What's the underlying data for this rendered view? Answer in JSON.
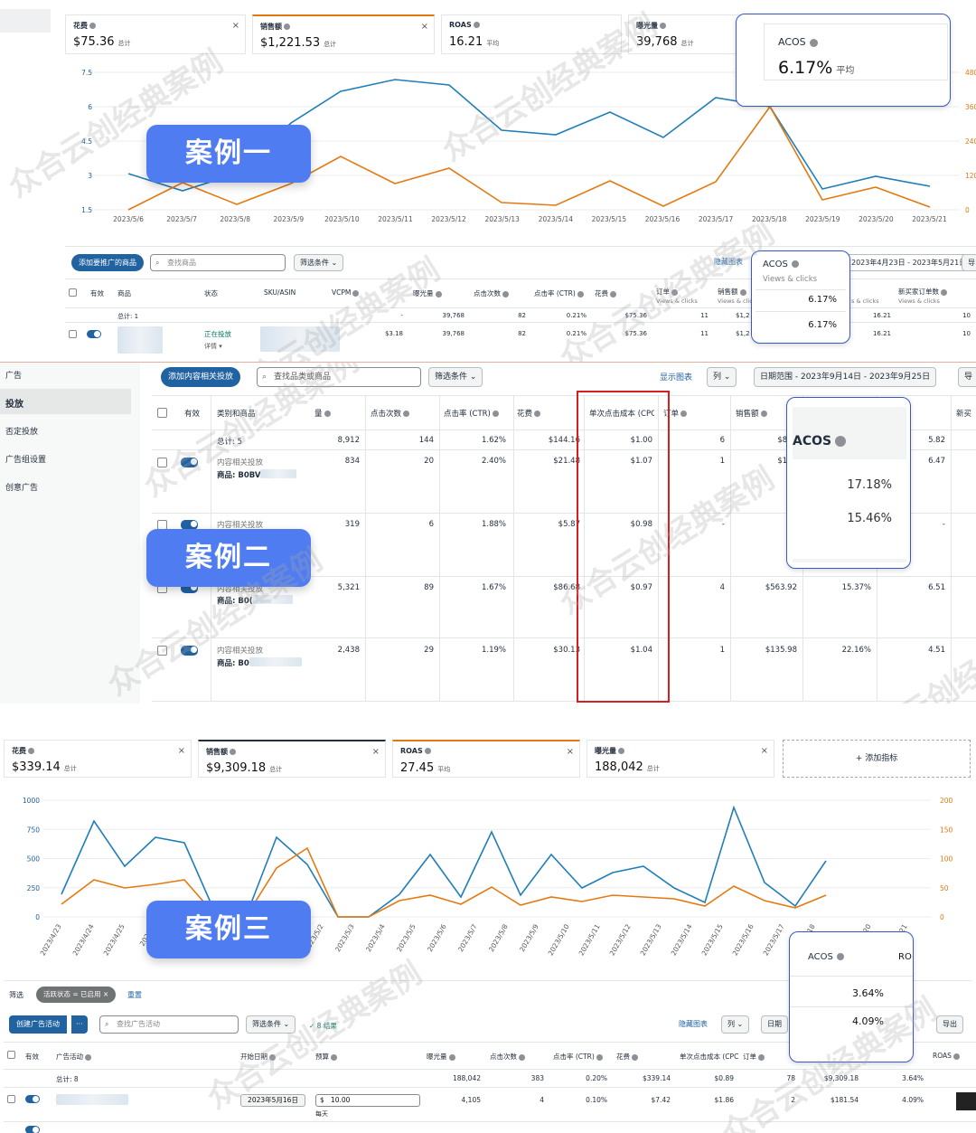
{
  "watermark": "众合云创经典案例",
  "case1": {
    "badge": "案例一",
    "metrics": [
      {
        "title": "花费",
        "value": "$75.36",
        "sub": "总计",
        "accent": "#e3e6e6"
      },
      {
        "title": "销售额",
        "value": "$1,221.53",
        "sub": "总计",
        "accent": "#e47911"
      },
      {
        "title": "ROAS",
        "value": "16.21",
        "sub": "平均",
        "accent": "#e3e6e6"
      },
      {
        "title": "曝光量",
        "value": "39,768",
        "sub": "总计",
        "accent": "#e3e6e6"
      }
    ],
    "acos_card": {
      "title": "ACOS",
      "value": "6.17%",
      "sub": "平均"
    },
    "close_glyph": "×",
    "chart": {
      "left_ticks": [
        "7.5",
        "6",
        "4.5",
        "3",
        "1.5"
      ],
      "right_ticks": [
        "480",
        "360",
        "240",
        "120",
        "0"
      ],
      "x_labels": [
        "2023/5/6",
        "2023/5/7",
        "2023/5/8",
        "2023/5/9",
        "2023/5/10",
        "2023/5/11",
        "2023/5/12",
        "2023/5/13",
        "2023/5/14",
        "2023/5/15",
        "2023/5/16",
        "2023/5/17",
        "2023/5/18",
        "2023/5/19",
        "2023/5/20",
        "2023/5/21"
      ]
    },
    "toolbar": {
      "add_button": "添加要推广的商品",
      "search_placeholder": "查找商品",
      "filter": "筛选条件",
      "hide_chart": "隐藏图表",
      "date_range": "2023年4月23日 - 2023年5月21日",
      "export": "导"
    },
    "table": {
      "headers": [
        "有效",
        "商品",
        "状态",
        "SKU/ASIN",
        "VCPM",
        "曝光量",
        "点击次数",
        "点击率 (CTR)",
        "花费",
        "订单",
        "销售额",
        "ACOS",
        "ROAS",
        "新买家订单数"
      ],
      "sub_headers": {
        "orders": "Views & clicks",
        "sales": "Views & clic",
        "roas": "s & clicks",
        "new": "Views & clicks"
      },
      "total_label": "总计: 1",
      "total": {
        "vcpm": "-",
        "impressions": "39,768",
        "clicks": "82",
        "ctr": "0.21%",
        "spend": "$75.36",
        "orders": "11",
        "sales": "$1,2",
        "roas": "16.21",
        "new": "10"
      },
      "row": {
        "status": "正在投放",
        "detail": "详情",
        "vcpm": "$3.18",
        "impressions": "39,768",
        "clicks": "82",
        "ctr": "0.21%",
        "spend": "$75.36",
        "orders": "11",
        "sales": "$1,2",
        "roas": "16.21",
        "new": "10"
      }
    },
    "acos_callout": {
      "title": "ACOS",
      "sub": "Views & clicks",
      "v1": "6.17%",
      "v2": "6.17%"
    }
  },
  "case2": {
    "badge": "案例二",
    "sidebar": [
      "广告",
      "投放",
      "否定投放",
      "广告组设置",
      "创意广告"
    ],
    "toolbar": {
      "add_button": "添加内容相关投放",
      "search_placeholder": "查找品类或商品",
      "filter": "筛选条件",
      "show_chart": "显示图表",
      "columns": "列",
      "date_range": "日期范围 - 2023年9月14日 - 2023年9月25日",
      "export": "导"
    },
    "headers": [
      "有效",
      "类别和商品",
      "量",
      "点击次数",
      "点击率 (CTR)",
      "花费",
      "单次点击成本 (CPC)",
      "订单",
      "销售额",
      "ACOS",
      "新买"
    ],
    "total": {
      "label": "总计: 5",
      "impr": "8,912",
      "clicks": "144",
      "ctr": "1.62%",
      "spend": "$144.16",
      "cpc": "$1.00",
      "orders": "6",
      "sales": "$838",
      "new": "5.82"
    },
    "rows": [
      {
        "cat": "内容相关投放",
        "prod": "商品: B0BV",
        "impr": "834",
        "clicks": "20",
        "ctr": "2.40%",
        "spend": "$21.48",
        "cpc": "$1.07",
        "orders": "1",
        "sales": "$138",
        "acos": "",
        "new": "6.47"
      },
      {
        "cat": "内容相关投放",
        "prod": "",
        "impr": "319",
        "clicks": "6",
        "ctr": "1.88%",
        "spend": "$5.87",
        "cpc": "$0.98",
        "orders": "-",
        "sales": "",
        "acos": "",
        "new": "-"
      },
      {
        "cat": "内容相关投放",
        "prod": "商品: B0(",
        "impr": "5,321",
        "clicks": "89",
        "ctr": "1.67%",
        "spend": "$86.68",
        "cpc": "$0.97",
        "orders": "4",
        "sales": "$563.92",
        "acos": "15.37%",
        "new": "6.51"
      },
      {
        "cat": "内容相关投放",
        "prod": "商品: B0",
        "impr": "2,438",
        "clicks": "29",
        "ctr": "1.19%",
        "spend": "$30.13",
        "cpc": "$1.04",
        "orders": "1",
        "sales": "$135.98",
        "acos": "22.16%",
        "new": "4.51"
      }
    ],
    "acos_callout": {
      "title": "ACOS",
      "v1": "17.18%",
      "v2": "15.46%"
    }
  },
  "case3": {
    "badge": "案例三",
    "metrics": [
      {
        "title": "花费",
        "value": "$339.14",
        "sub": "总计",
        "accent": "#e3e6e6"
      },
      {
        "title": "销售额",
        "value": "$9,309.18",
        "sub": "总计",
        "accent": "#232f3e"
      },
      {
        "title": "ROAS",
        "value": "27.45",
        "sub": "平均",
        "accent": "#e47911"
      },
      {
        "title": "曝光量",
        "value": "188,042",
        "sub": "总计",
        "accent": "#e3e6e6"
      }
    ],
    "add_metric": "+ 添加指标",
    "chart": {
      "left_ticks": [
        "1000",
        "750",
        "500",
        "250",
        "0"
      ],
      "right_ticks": [
        "200",
        "150",
        "100",
        "50",
        "0"
      ],
      "x_labels": [
        "2023/4/23",
        "2023/4/24",
        "2023/4/25",
        "2023/4",
        "2023/5/2",
        "2023/5/3",
        "2023/5/4",
        "2023/5/5",
        "2023/5/6",
        "2023/5/7",
        "2023/5/8",
        "2023/5/9",
        "2023/5/10",
        "2023/5/11",
        "2023/5/12",
        "2023/5/13",
        "2023/5/14",
        "2023/5/15",
        "2023/5/16",
        "2023/5/17",
        "18",
        "20",
        "21"
      ]
    },
    "filter_row": {
      "label": "筛选",
      "chip": "活跃状态 = 已启用",
      "reset": "重置"
    },
    "toolbar": {
      "create": "创建广告活动",
      "more": "···",
      "search_placeholder": "查找广告活动",
      "filter": "筛选条件",
      "results": "8 结果",
      "hide_chart": "隐藏图表",
      "columns": "列",
      "date": "日期",
      "export": "导出"
    },
    "headers": [
      "有效",
      "广告活动",
      "开始日期",
      "预算",
      "曝光量",
      "点击次数",
      "点击率 (CTR)",
      "花费",
      "单次点击成本 (CPC)",
      "订单",
      "销售额",
      "ACOS",
      "ROAS"
    ],
    "total": {
      "label": "总计: 8",
      "impr": "188,042",
      "clicks": "383",
      "ctr": "0.20%",
      "spend": "$339.14",
      "cpc": "$0.89",
      "orders": "78",
      "sales": "$9,309.18",
      "acos": "3.64%"
    },
    "row": {
      "date": "2023年5月16日",
      "budget_prefix": "$",
      "budget": "10.00",
      "budget_note": "每天",
      "impr": "4,105",
      "clicks": "4",
      "ctr": "0.10%",
      "spend": "$7.42",
      "cpc": "$1.86",
      "orders": "2",
      "sales": "$181.54",
      "acos": "4.09%"
    },
    "acos_callout": {
      "title": "ACOS",
      "ro": "RO",
      "v1": "3.64%",
      "v2": "4.09%"
    }
  },
  "colors": {
    "blue_line": "#1f7eb9",
    "orange_line": "#e47911",
    "badge": "#4f7cf0",
    "callout_border": "#3b57c4",
    "highlight_red": "#d62020",
    "link": "#2162a1"
  }
}
